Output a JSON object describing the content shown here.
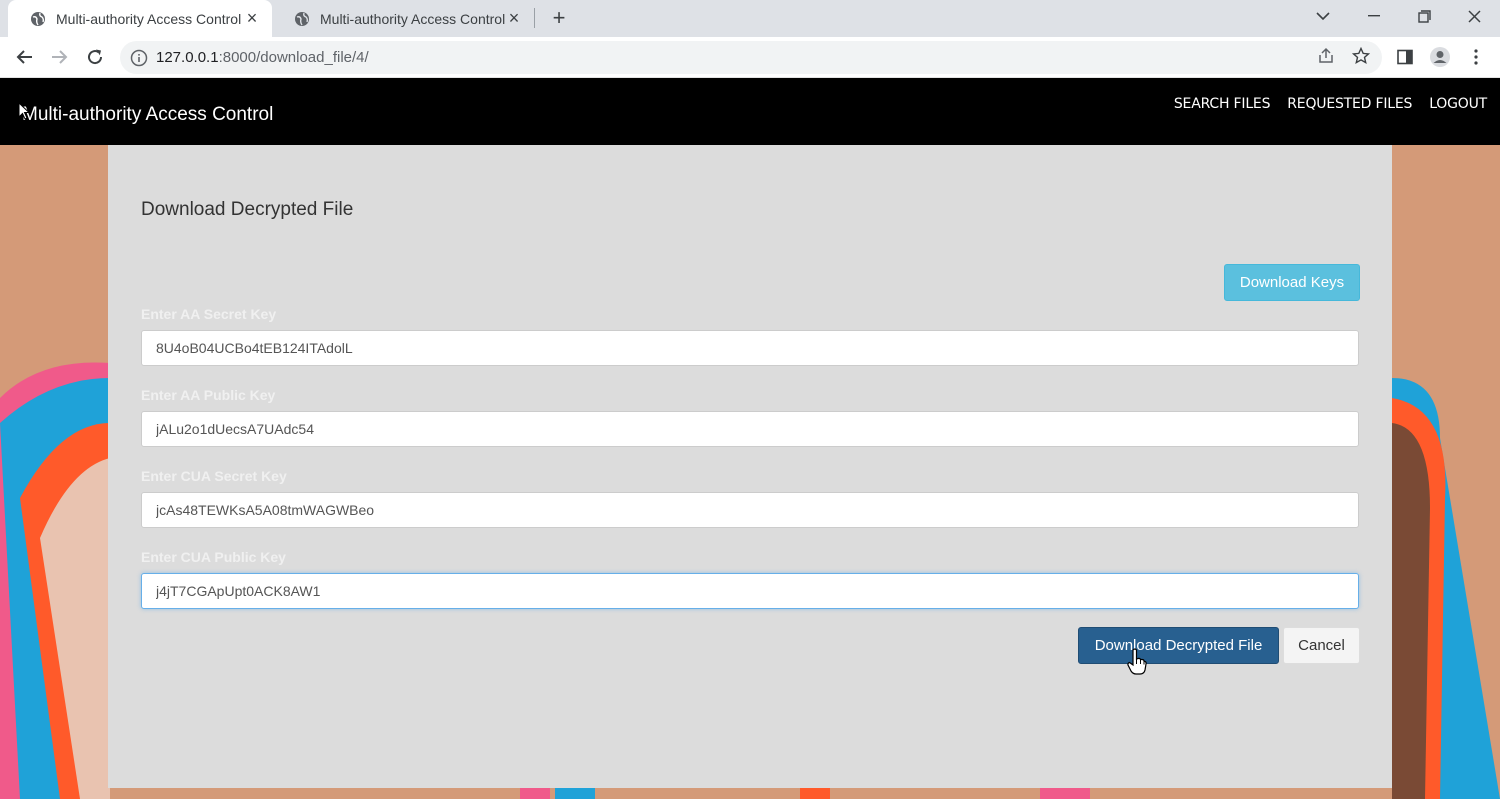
{
  "browser": {
    "tabs": [
      {
        "title": "Multi-authority Access Control",
        "active": true
      },
      {
        "title": "Multi-authority Access Control",
        "active": false
      }
    ],
    "url_host": "127.0.0.1",
    "url_rest": ":8000/download_file/4/"
  },
  "navbar": {
    "brand": "Multi-authority Access Control",
    "links": [
      "SEARCH FILES",
      "REQUESTED FILES",
      "LOGOUT"
    ]
  },
  "form": {
    "title": "Download Decrypted File",
    "download_keys_label": "Download Keys",
    "fields": [
      {
        "label": "Enter AA Secret Key",
        "value": "8U4oB04UCBo4tEB124ITAdolL"
      },
      {
        "label": "Enter AA Public Key",
        "value": "jALu2o1dUecsA7UAdc54"
      },
      {
        "label": "Enter CUA Secret Key",
        "value": "jcAs48TEWKsA5A08tmWAGWBeo"
      },
      {
        "label": "Enter CUA Public Key",
        "value": "j4jT7CGApUpt0ACK8AW1"
      }
    ],
    "submit_label": "Download Decrypted File",
    "cancel_label": "Cancel"
  },
  "colors": {
    "navbar": "#000000",
    "panel": "#dcdcdc",
    "info_button": "#5bc0de",
    "primary_button": "#286090"
  }
}
